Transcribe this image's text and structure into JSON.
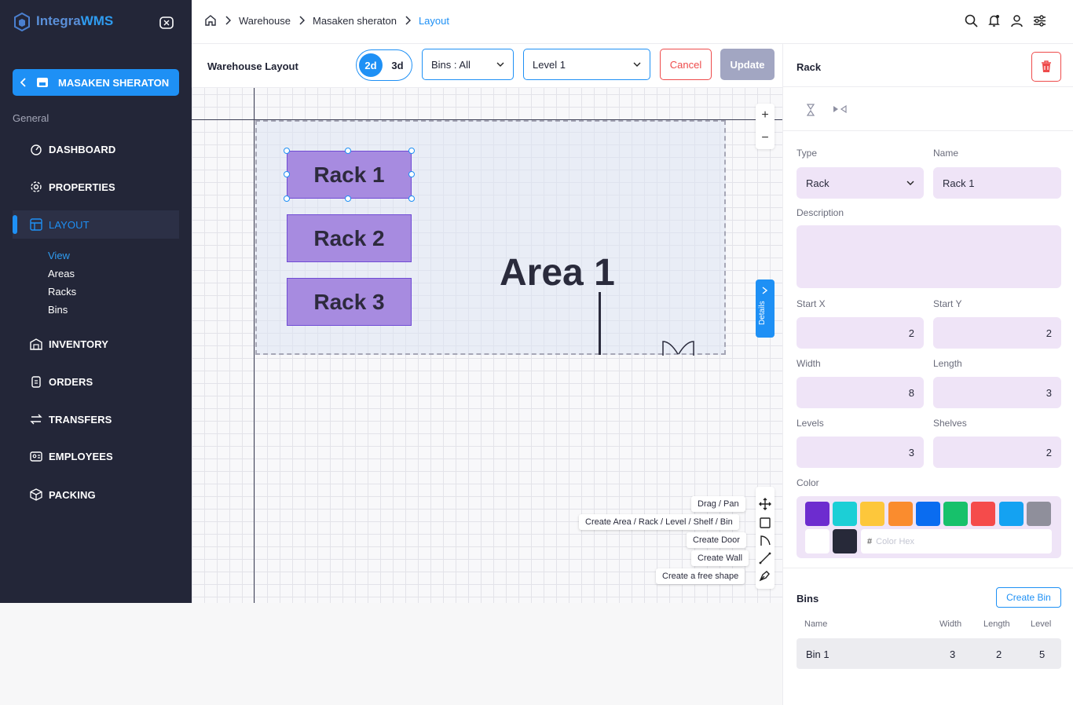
{
  "app": {
    "logo_part1": "Integra",
    "logo_part2": "WMS"
  },
  "sidebar": {
    "workspace": "MASAKEN SHERATON",
    "section_label": "General",
    "items": [
      {
        "label": "DASHBOARD",
        "icon": "dashboard-icon"
      },
      {
        "label": "PROPERTIES",
        "icon": "gear-icon"
      },
      {
        "label": "LAYOUT",
        "icon": "layout-icon",
        "active": true
      },
      {
        "label": "INVENTORY",
        "icon": "warehouse-icon"
      },
      {
        "label": "ORDERS",
        "icon": "orders-icon"
      },
      {
        "label": "TRANSFERS",
        "icon": "transfer-icon"
      },
      {
        "label": "EMPLOYEES",
        "icon": "id-card-icon"
      },
      {
        "label": "PACKING",
        "icon": "package-icon"
      }
    ],
    "layout_subitems": [
      {
        "label": "View",
        "active": true
      },
      {
        "label": "Areas"
      },
      {
        "label": "Racks"
      },
      {
        "label": "Bins"
      }
    ]
  },
  "breadcrumb": [
    "Warehouse",
    "Masaken sheraton",
    "Layout"
  ],
  "toolbar": {
    "title": "Warehouse Layout",
    "view_2d": "2d",
    "view_3d": "3d",
    "bins_select": "Bins : All",
    "level_select": "Level 1",
    "cancel": "Cancel",
    "update": "Update"
  },
  "canvas": {
    "area_label": "Area 1",
    "racks": [
      "Rack 1",
      "Rack 2",
      "Rack 3"
    ],
    "zoom_in": "+",
    "zoom_out": "−",
    "details_tab": "Details",
    "tooltips": {
      "drag": "Drag / Pan",
      "create": "Create Area  / Rack /  Level / Shelf / Bin",
      "door": "Create Door",
      "wall": "Create Wall",
      "shape": "Create a free shape"
    }
  },
  "panel": {
    "title": "Rack",
    "type_label": "Type",
    "type_value": "Rack",
    "name_label": "Name",
    "name_value": "Rack 1",
    "description_label": "Description",
    "description_value": "",
    "start_x_label": "Start X",
    "start_x": "2",
    "start_y_label": "Start Y",
    "start_y": "2",
    "width_label": "Width",
    "width": "8",
    "length_label": "Length",
    "length": "3",
    "levels_label": "Levels",
    "levels": "3",
    "shelves_label": "Shelves",
    "shelves": "2",
    "color_label": "Color",
    "swatches": [
      "#6d2ccf",
      "#1ccfd6",
      "#fdc73b",
      "#fa8c2e",
      "#0a6cf0",
      "#17c16b",
      "#f54b4b",
      "#14a2f2",
      "#8f8f9b",
      "#ffffff",
      "#272939"
    ],
    "hex_placeholder": "Color Hex",
    "hex_hash": "#",
    "bins_title": "Bins",
    "create_bin": "Create Bin",
    "bins_columns": [
      "Name",
      "Width",
      "Length",
      "Level"
    ],
    "bins_rows": [
      {
        "name": "Bin 1",
        "width": "3",
        "length": "2",
        "level": "5"
      }
    ]
  }
}
